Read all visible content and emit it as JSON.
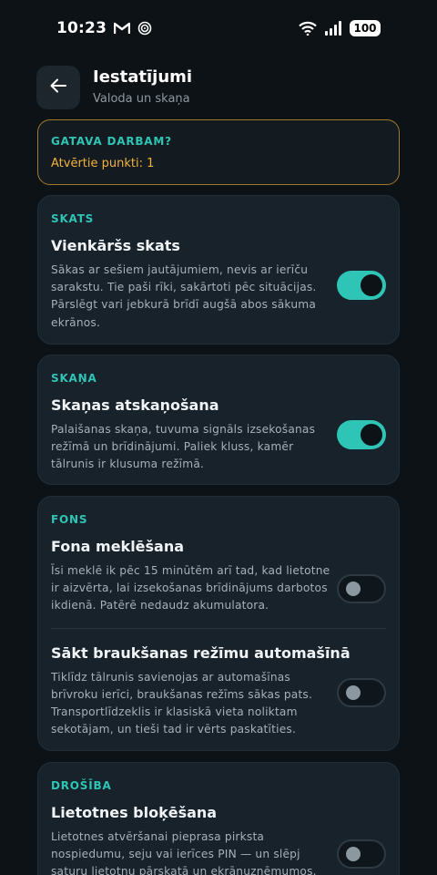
{
  "status_bar": {
    "time": "10:23",
    "battery": "100",
    "icons": [
      "gmail-icon",
      "sync-icon",
      "wifi-icon",
      "signal-icon",
      "battery-icon"
    ]
  },
  "header": {
    "title": "Iestatījumi",
    "subtitle": "Valoda un skaņa"
  },
  "ready": {
    "title": "GATAVA DARBAM?",
    "points": "Atvērtie punkti: 1"
  },
  "sections": {
    "view": {
      "label": "SKATS",
      "simple": {
        "title": "Vienkāršs skats",
        "desc": "Sākas ar sešiem jautājumiem, nevis ar ierīču sarakstu. Tie paši rīki, sakārtoti pēc situācijas. Pārslēgt vari jebkurā brīdī augšā abos sākuma ekrānos.",
        "enabled": true
      }
    },
    "sound": {
      "label": "SKAŅA",
      "playback": {
        "title": "Skaņas atskaņošana",
        "desc": "Palaišanas skaņa, tuvuma signāls izsekošanas režīmā un brīdinājumi. Paliek kluss, kamēr tālrunis ir klusuma režīmā.",
        "enabled": true
      }
    },
    "background": {
      "label": "FONS",
      "search": {
        "title": "Fona meklēšana",
        "desc": "Īsi meklē ik pēc 15 minūtēm arī tad, kad lietotne ir aizvērta, lai izsekošanas brīdinājums darbotos ikdienā. Patērē nedaudz akumulatora.",
        "enabled": false
      },
      "driving": {
        "title": "Sākt braukšanas režīmu automašīnā",
        "desc": "Tiklīdz tālrunis savienojas ar automašīnas brīvroku ierīci, braukšanas režīms sākas pats. Transportlīdzeklis ir klasiskā vieta noliktam sekotājam, un tieši tad ir vērts paskatīties.",
        "enabled": false
      }
    },
    "security": {
      "label": "DROŠĪBA",
      "lock": {
        "title": "Lietotnes bloķēšana",
        "desc": "Lietotnes atvēršanai pieprasa pirksta nospiedumu, seju vai ierīces PIN — un slēpj saturu lietotņu pārskatā un ekrānuzņēmumos.",
        "enabled": false
      }
    }
  },
  "colors": {
    "accent": "#2ec4b6",
    "warning": "#f2b23a",
    "background": "#0d1216",
    "card": "#18222a"
  }
}
